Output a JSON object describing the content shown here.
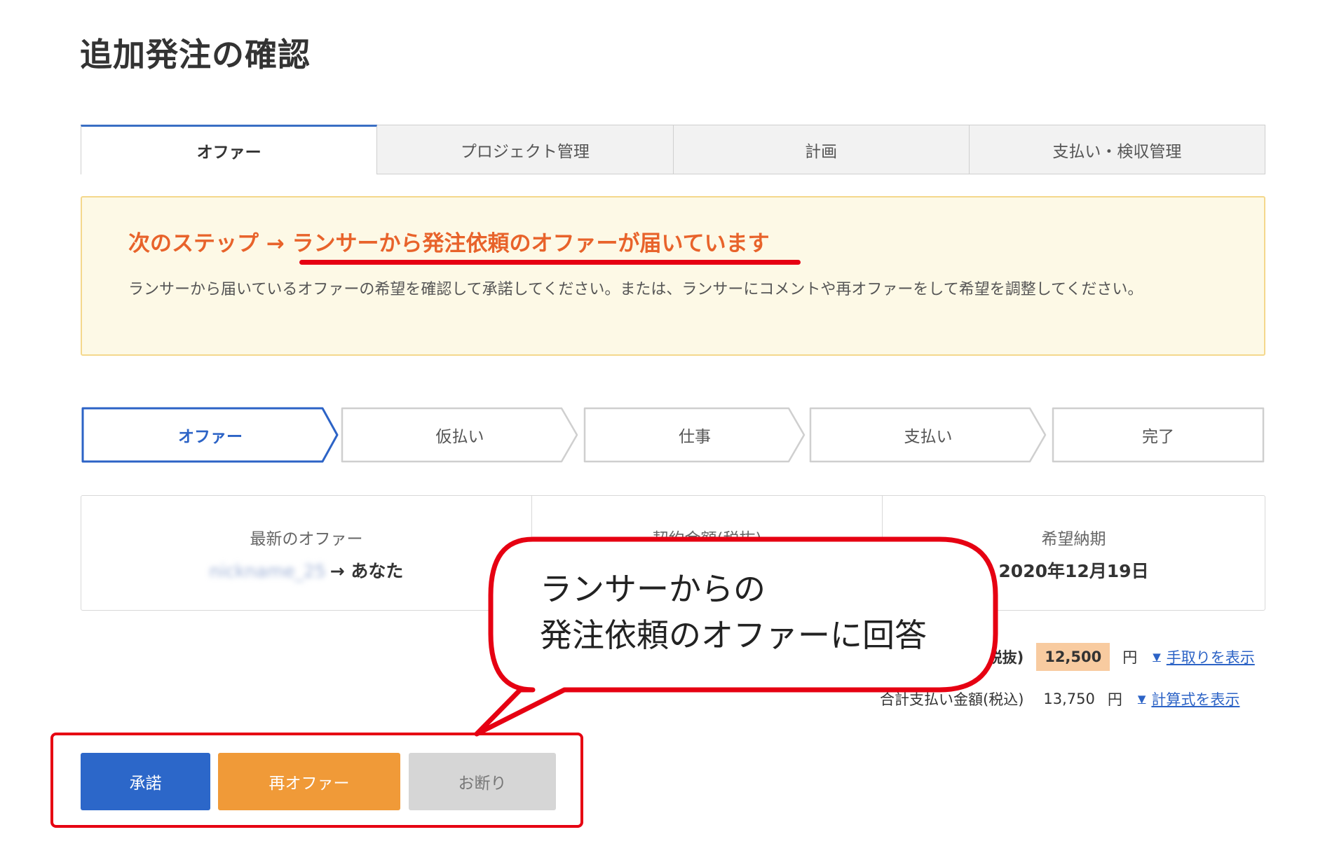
{
  "page": {
    "title": "追加発注の確認"
  },
  "tabs": [
    {
      "label": "オファー",
      "active": true
    },
    {
      "label": "プロジェクト管理",
      "active": false
    },
    {
      "label": "計画",
      "active": false
    },
    {
      "label": "支払い・検収管理",
      "active": false
    }
  ],
  "notice": {
    "heading": "次のステップ → ランサーから発注依頼のオファーが届いています",
    "body": "ランサーから届いているオファーの希望を確認して承諾してください。または、ランサーにコメントや再オファーをして希望を調整してください。"
  },
  "steps": [
    {
      "label": "オファー",
      "active": true
    },
    {
      "label": "仮払い",
      "active": false
    },
    {
      "label": "仕事",
      "active": false
    },
    {
      "label": "支払い",
      "active": false
    },
    {
      "label": "完了",
      "active": false
    }
  ],
  "info": {
    "latest_offer_label": "最新のオファー",
    "latest_offer_from": "nickname_25",
    "latest_offer_to": "→ あなた",
    "contract_amount_label": "契約金額(税抜)",
    "deadline_label": "希望納期",
    "deadline_value": "2020年12月19日"
  },
  "amounts": {
    "row1_label": "額(税抜)",
    "row1_value": "12,500",
    "row1_yen": "円",
    "row1_link": "手取りを表示",
    "row2_label": "合計支払い金額(税込)",
    "row2_value": "13,750",
    "row2_yen": "円",
    "row2_link": "計算式を表示"
  },
  "buttons": {
    "accept": "承諾",
    "reoffer": "再オファー",
    "decline": "お断り"
  },
  "callout": {
    "line1": "ランサーからの",
    "line2": "発注依頼のオファーに回答"
  },
  "colors": {
    "accent_blue": "#2c67c9",
    "accent_orange": "#f09a38",
    "notice_heading": "#e8632b",
    "annotation_red": "#e60012"
  }
}
